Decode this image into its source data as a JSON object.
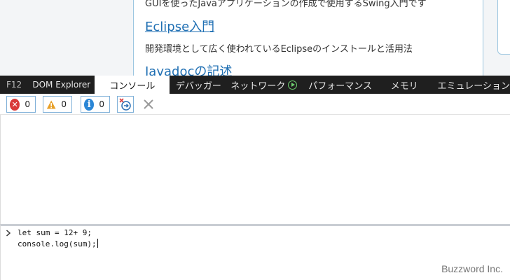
{
  "webpage": {
    "line_swing": "GUIを使ったJavaアプリケーションの作成で使用するSwing入門です",
    "link_eclipse": "Eclipse入門",
    "line_eclipse_desc": "開発環境として広く使われているEclipseのインストールと活用法",
    "link_javadoc": "Javadocの記述",
    "link_color": "#1f6fb3"
  },
  "devtools": {
    "tabs": [
      {
        "label": "F12"
      },
      {
        "label": "DOM Explorer"
      },
      {
        "label": "コンソール",
        "active": true
      },
      {
        "label": "デバッガー"
      },
      {
        "label": "ネットワーク",
        "icon": "play-circle-icon"
      },
      {
        "label": "パフォーマンス"
      },
      {
        "label": "メモリ"
      },
      {
        "label": "エミュレーション"
      }
    ]
  },
  "toolbar": {
    "error_count": "0",
    "warning_count": "0",
    "info_count": "0",
    "error_color": "#d93a3a",
    "warning_color": "#e8a028",
    "info_color": "#2a86d6"
  },
  "console": {
    "input_lines": [
      "let sum = 12+ 9;",
      "console.log(sum);"
    ]
  },
  "watermark": "Buzzword Inc."
}
